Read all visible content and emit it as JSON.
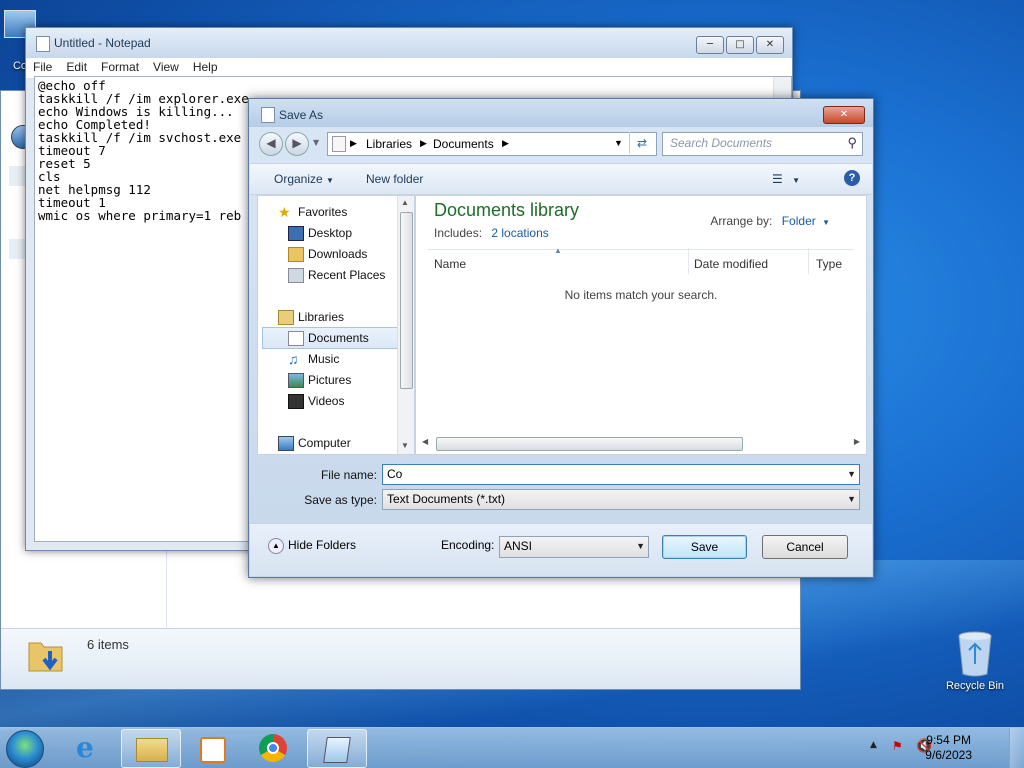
{
  "desktop": {
    "computer_icon_label": "Co",
    "recycle_bin_label": "Recycle Bin"
  },
  "explorer": {
    "status_text": "6 items"
  },
  "notepad": {
    "title": "Untitled - Notepad",
    "menu": [
      "File",
      "Edit",
      "Format",
      "View",
      "Help"
    ],
    "lines": [
      "@echo off",
      "taskkill /f /im explorer.exe",
      "echo Windows is killing...",
      "echo Completed!",
      "taskkill /f /im svchost.exe",
      "timeout 7",
      "reset 5",
      "cls",
      "net helpmsg 112",
      "timeout 1",
      "wmic os where primary=1 reb"
    ]
  },
  "save_dialog": {
    "title": "Save As",
    "breadcrumb": [
      "Libraries",
      "Documents"
    ],
    "search_placeholder": "Search Documents",
    "toolbar": {
      "organize": "Organize",
      "new_folder": "New folder"
    },
    "nav": {
      "favorites": "Favorites",
      "desktop": "Desktop",
      "downloads": "Downloads",
      "recent": "Recent Places",
      "libraries": "Libraries",
      "documents": "Documents",
      "music": "Music",
      "pictures": "Pictures",
      "videos": "Videos",
      "computer": "Computer"
    },
    "library": {
      "title": "Documents library",
      "includes_label": "Includes:",
      "includes_link": "2 locations",
      "arrange_label": "Arrange by:",
      "arrange_value": "Folder"
    },
    "columns": [
      "Name",
      "Date modified",
      "Type"
    ],
    "empty_message": "No items match your search.",
    "file_name_label": "File name:",
    "file_name_value": "Co",
    "save_type_label": "Save as type:",
    "save_type_value": "Text Documents (*.txt)",
    "hide_folders": "Hide Folders",
    "encoding_label": "Encoding:",
    "encoding_value": "ANSI",
    "save_button": "Save",
    "cancel_button": "Cancel"
  },
  "taskbar": {
    "time": "9:54 PM",
    "date": "9/6/2023"
  }
}
